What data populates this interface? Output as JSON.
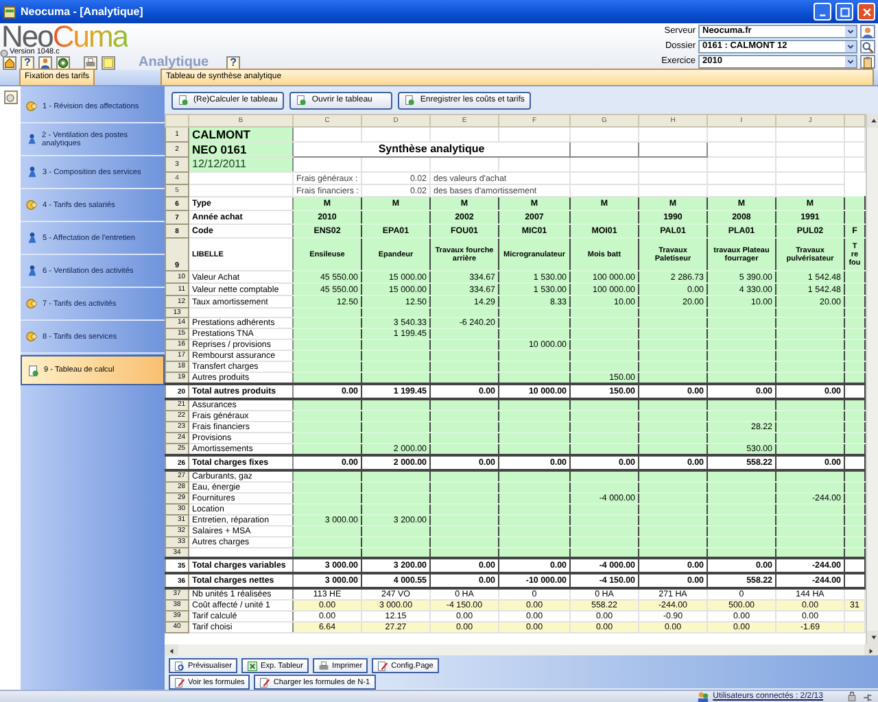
{
  "window": {
    "title": "Neocuma - [Analytique]"
  },
  "header": {
    "logo": {
      "part_1": "Neo",
      "part_2": "Cuma"
    },
    "version": "Version 1048.c",
    "toolbar_help": "?",
    "module": "Analytique",
    "module_help": "?",
    "fields": [
      {
        "label": "Serveur",
        "value": "Neocuma.fr",
        "kind": "user"
      },
      {
        "label": "Dossier",
        "value": "0161 : CALMONT 12",
        "kind": "search"
      },
      {
        "label": "Exercice",
        "value": "2010",
        "kind": "clipboard"
      }
    ]
  },
  "sidebar": {
    "tab": "Fixation des tarifs",
    "items": [
      {
        "label": "1 - Révision des affectations",
        "kind": "coins",
        "selected": false
      },
      {
        "label": "2 - Ventilation des postes analytiques",
        "kind": "person",
        "selected": false
      },
      {
        "label": "3 - Composition des services",
        "kind": "person",
        "selected": false
      },
      {
        "label": "4 - Tarifs des salariés",
        "kind": "coins",
        "selected": false
      },
      {
        "label": "5 - Affectation de l'entretien",
        "kind": "person",
        "selected": false
      },
      {
        "label": "6 - Ventilation des activités",
        "kind": "person",
        "selected": false
      },
      {
        "label": "7 - Tarifs des activités",
        "kind": "coins",
        "selected": false
      },
      {
        "label": "8 - Tarifs des services",
        "kind": "coins",
        "selected": false
      },
      {
        "label": "9 - Tableau de calcul",
        "kind": "sheet",
        "selected": true
      }
    ]
  },
  "main": {
    "tab": "Tableau de synthèse analytique",
    "actions": [
      "(Re)Calculer le tableau",
      "Ouvrir le tableau",
      "Enregistrer les coûts et tarifs"
    ],
    "sheet": {
      "columns": [
        "B",
        "C",
        "D",
        "E",
        "F",
        "G",
        "H",
        "I",
        "J"
      ],
      "rows": [
        {
          "num": "1",
          "kind": "title",
          "label": "CALMONT"
        },
        {
          "num": "2",
          "kind": "title",
          "label": "NEO 0161",
          "caption": "Synthèse analytique"
        },
        {
          "num": "3",
          "kind": "subtitle",
          "label": "12/12/2011"
        },
        {
          "num": "4",
          "kind": "note",
          "cells": [
            "Frais généraux :",
            "0.02",
            "des valeurs d'achat"
          ]
        },
        {
          "num": "5",
          "kind": "note",
          "cells": [
            "Frais financiers :",
            "0.02",
            "des bases d'amortissement"
          ]
        },
        {
          "num": "6",
          "kind": "attribute",
          "label": "Type",
          "cells": [
            "M",
            "M",
            "M",
            "M",
            "M",
            "M",
            "M",
            "M"
          ]
        },
        {
          "num": "7",
          "kind": "attribute",
          "label": "Année achat",
          "cells": [
            "2010",
            null,
            "2002",
            "2007",
            null,
            "1990",
            "2008",
            "1991"
          ]
        },
        {
          "num": "8",
          "kind": "attribute",
          "label": "Code",
          "cells": [
            "ENS02",
            "EPA01",
            "FOU01",
            "MIC01",
            "MOI01",
            "PAL01",
            "PLA01",
            "PUL02",
            "F"
          ]
        },
        {
          "num": "9",
          "kind": "description",
          "label": "LIBELLE",
          "cells": [
            "Ensileuse",
            "Epandeur",
            "Travaux fourche arrière",
            "Microgranulateur",
            "Mois batt",
            "Travaux Paletiseur",
            "travaux Plateau fourrager",
            "Travaux pulvérisateur",
            "T re fou"
          ]
        },
        {
          "num": "10",
          "kind": "asset",
          "label": "Valeur Achat",
          "cells": [
            "45 550.00",
            "15 000.00",
            "334.67",
            "1 530.00",
            "100 000.00",
            "2 286.73",
            "5 390.00",
            "1 542.48"
          ]
        },
        {
          "num": "11",
          "kind": "asset",
          "label": "Valeur nette comptable",
          "cells": [
            "45 550.00",
            "15 000.00",
            "334.67",
            "1 530.00",
            "100 000.00",
            "0.00",
            "4 330.00",
            "1 542.48"
          ]
        },
        {
          "num": "12",
          "kind": "asset",
          "label": "Taux amortissement",
          "cells": [
            "12.50",
            "12.50",
            "14.29",
            "8.33",
            "10.00",
            "20.00",
            "10.00",
            "20.00"
          ]
        },
        {
          "num": "13",
          "kind": "gap"
        },
        {
          "num": "14",
          "kind": "value",
          "label": "Prestations adhérents",
          "cells": [
            null,
            "3 540.33",
            "-6 240.20"
          ]
        },
        {
          "num": "15",
          "kind": "value",
          "label": "Prestations TNA",
          "cells": [
            null,
            "1 199.45"
          ]
        },
        {
          "num": "16",
          "kind": "value",
          "label": "Reprises / provisions",
          "cells": [
            null,
            null,
            null,
            "10 000.00"
          ]
        },
        {
          "num": "17",
          "kind": "value",
          "label": "Rembourst assurance"
        },
        {
          "num": "18",
          "kind": "value",
          "label": "Transfert charges"
        },
        {
          "num": "19",
          "kind": "value",
          "label": "Autres produits",
          "cells": [
            null,
            null,
            null,
            null,
            "150.00"
          ]
        },
        {
          "num": "20",
          "kind": "total",
          "label": "Total autres produits",
          "cells": [
            "0.00",
            "1 199.45",
            "0.00",
            "10 000.00",
            "150.00",
            "0.00",
            "0.00",
            "0.00"
          ]
        },
        {
          "num": "21",
          "kind": "value",
          "label": "Assurances"
        },
        {
          "num": "22",
          "kind": "value",
          "label": "Frais généraux"
        },
        {
          "num": "23",
          "kind": "value",
          "label": "Frais financiers",
          "cells": [
            null,
            null,
            null,
            null,
            null,
            null,
            "28.22"
          ]
        },
        {
          "num": "24",
          "kind": "value",
          "label": "Provisions"
        },
        {
          "num": "25",
          "kind": "value",
          "label": "Amortissements",
          "cells": [
            null,
            "2 000.00",
            null,
            null,
            null,
            null,
            "530.00"
          ]
        },
        {
          "num": "26",
          "kind": "total",
          "label": "Total charges fixes",
          "cells": [
            "0.00",
            "2 000.00",
            "0.00",
            "0.00",
            "0.00",
            "0.00",
            "558.22",
            "0.00"
          ]
        },
        {
          "num": "27",
          "kind": "value",
          "label": "Carburants, gaz"
        },
        {
          "num": "28",
          "kind": "value",
          "label": "Eau, énergie"
        },
        {
          "num": "29",
          "kind": "value",
          "label": "Fournitures",
          "cells": [
            null,
            null,
            null,
            null,
            "-4 000.00",
            null,
            null,
            "-244.00"
          ]
        },
        {
          "num": "30",
          "kind": "value",
          "label": "Location"
        },
        {
          "num": "31",
          "kind": "value",
          "label": "Entretien, réparation",
          "cells": [
            "3 000.00",
            "3 200.00"
          ]
        },
        {
          "num": "32",
          "kind": "value",
          "label": "Salaires + MSA"
        },
        {
          "num": "33",
          "kind": "value",
          "label": "Autres charges"
        },
        {
          "num": "34",
          "kind": "gap"
        },
        {
          "num": "35",
          "kind": "total",
          "label": "Total charges variables",
          "cells": [
            "3 000.00",
            "3 200.00",
            "0.00",
            "0.00",
            "-4 000.00",
            "0.00",
            "0.00",
            "-244.00"
          ]
        },
        {
          "num": "36",
          "kind": "total",
          "label": "Total charges nettes",
          "cells": [
            "3 000.00",
            "4 000.55",
            "0.00",
            "-10 000.00",
            "-4 150.00",
            "0.00",
            "558.22",
            "-244.00"
          ]
        },
        {
          "num": "37",
          "kind": "result",
          "label": "Nb unités 1 réalisées",
          "cells": [
            "113 HE",
            "247 VO",
            "0 HA",
            "0",
            "0 HA",
            "271 HA",
            "0",
            "144 HA"
          ]
        },
        {
          "num": "38",
          "kind": "highlight",
          "label": "Coût affecté / unité 1",
          "cells": [
            "0.00",
            "3 000.00",
            "-4 150.00",
            "0.00",
            "558.22",
            "-244.00",
            "500.00",
            "0.00",
            "31"
          ]
        },
        {
          "num": "39",
          "kind": "result",
          "label": "Tarif calculé",
          "cells": [
            "0.00",
            "12.15",
            "0.00",
            "0.00",
            "0.00",
            "-0.90",
            "0.00",
            "0.00"
          ]
        },
        {
          "num": "40",
          "kind": "highlight",
          "label": "Tarif choisi",
          "cells": [
            "6.64",
            "27.27",
            "0.00",
            "0.00",
            "0.00",
            "0.00",
            "0.00",
            "-1.69"
          ]
        }
      ]
    },
    "bottom_buttons": [
      [
        {
          "label": "Prévisualiser",
          "kind": "preview"
        },
        {
          "label": "Exp. Tableur",
          "kind": "export"
        },
        {
          "label": "Imprimer",
          "kind": "print"
        },
        {
          "label": "Config.Page",
          "kind": "edit"
        }
      ],
      [
        {
          "label": "Voir les formules",
          "kind": "edit"
        },
        {
          "label": "Charger  les formules de N-1",
          "kind": "edit"
        }
      ]
    ]
  },
  "status_bar": {
    "users": "Utilisateurs connectés : 2/2/13"
  }
}
